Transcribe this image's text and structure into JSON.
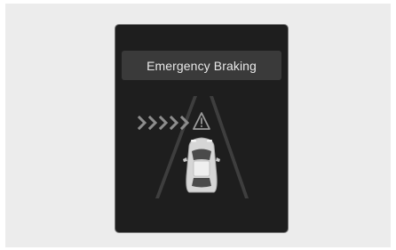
{
  "display": {
    "warning_message": "Emergency Braking"
  },
  "icons": {
    "approach_arrows": "chevron-right-icon",
    "warning": "warning-triangle-icon",
    "vehicle": "car-icon"
  },
  "colors": {
    "panel_background": "#1e1e1e",
    "banner_background": "#3a3a3a",
    "text": "#e8e8e8",
    "page_background": "#ececec"
  }
}
